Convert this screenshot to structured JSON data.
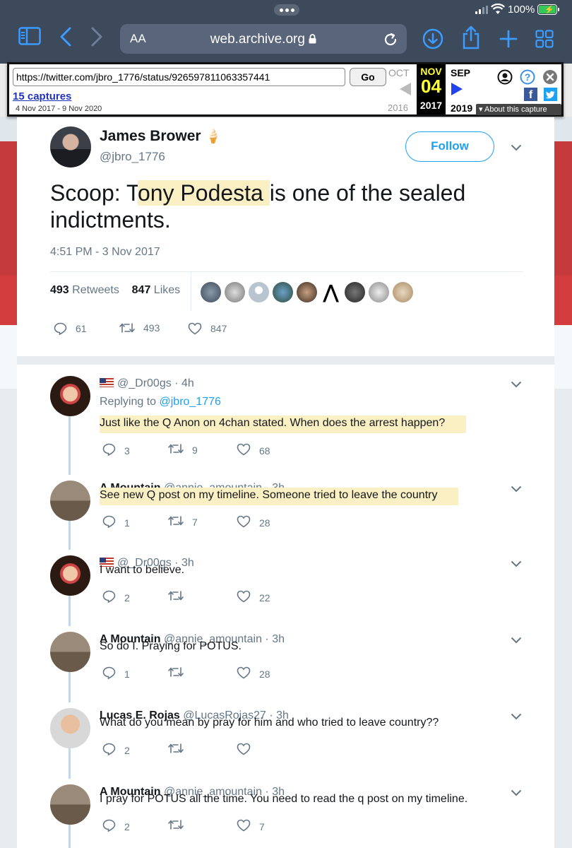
{
  "status": {
    "battery": "100%"
  },
  "browser": {
    "aa_label": "AA",
    "domain": "web.archive.org"
  },
  "wayback": {
    "url": "https://twitter.com/jbro_1776/status/926597811063357441",
    "go_label": "Go",
    "captures_label": "15 captures",
    "date_range": "4 Nov 2017 - 9 Nov 2020",
    "prev_month": "OCT",
    "prev_year": "2016",
    "cur_month": "NOV",
    "cur_day": "04",
    "cur_year": "2017",
    "next_month": "SEP",
    "next_year": "2019",
    "about_label": "About this capture"
  },
  "tweet": {
    "author_name": "James Brower",
    "author_emoji": "🍦",
    "author_handle": "@jbro_1776",
    "follow_label": "Follow",
    "text_prefix": "Scoop: T",
    "text_highlight": "ony Podesta ",
    "text_suffix_line1": "is one of the sealed",
    "text_line2": "indictments.",
    "timestamp": "4:51 PM - 3 Nov 2017",
    "retweets_count": "493",
    "retweets_label": "Retweets",
    "likes_count": "847",
    "likes_label": "Likes",
    "actions": {
      "replies": "61",
      "retweets": "493",
      "likes": "847"
    }
  },
  "replies": [
    {
      "name": "",
      "handle": "@_Dr00gs",
      "time": "· 4h",
      "flag": true,
      "replying_prefix": "Replying to ",
      "replying_to": "@jbro_1776",
      "text": "Just like the Q Anon on 4chan stated. When does the arrest happen?",
      "replies": "3",
      "retweets": "9",
      "likes": "68"
    },
    {
      "name": "A Mountain",
      "handle": "@annie_amountain",
      "time": "· 3h",
      "flag": false,
      "text": "See new Q post on my timeline. Someone tried to leave the country",
      "replies": "1",
      "retweets": "7",
      "likes": "28"
    },
    {
      "name": "",
      "handle": "@_Dr00gs",
      "time": "· 3h",
      "flag": true,
      "text": "I want to believe.",
      "replies": "2",
      "retweets": "",
      "likes": "22"
    },
    {
      "name": "A Mountain",
      "handle": "@annie_amountain",
      "time": "· 3h",
      "flag": false,
      "text": "So do I. Praying for POTUS.",
      "replies": "1",
      "retweets": "",
      "likes": "28"
    },
    {
      "name": "Lucas E. Rojas",
      "handle": "@LucasRojas27",
      "time": "· 3h",
      "flag": false,
      "text": "What do you mean by pray for him and who tried to leave country??",
      "replies": "2",
      "retweets": "",
      "likes": ""
    },
    {
      "name": "A Mountain",
      "handle": "@annie_amountain",
      "time": "· 3h",
      "flag": false,
      "text": "I pray for POTUS all the time. You need to read the q post on my timeline.",
      "replies": "2",
      "retweets": "",
      "likes": "7"
    }
  ],
  "colors": {
    "twitter_blue": "#1da1f2",
    "safari_blue": "#3b9bff",
    "highlight": "#fbf0c4"
  }
}
